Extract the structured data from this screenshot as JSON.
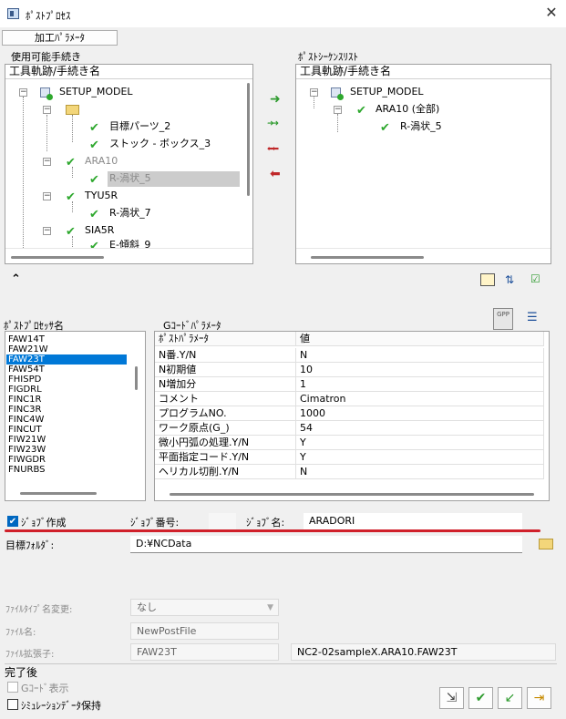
{
  "window": {
    "title": "ﾎﾟｽﾄﾌﾟﾛｾｽ",
    "close": "✕"
  },
  "tabs": {
    "processing_params": "加工ﾊﾟﾗﾒｰﾀ"
  },
  "available": {
    "label": "使用可能手続き",
    "column": "工具軌跡/手続き名",
    "rows": [
      {
        "text": "SETUP_MODEL"
      },
      {
        "text": ""
      },
      {
        "text": "目標パーツ_2"
      },
      {
        "text": "ストック - ボックス_3"
      },
      {
        "text": "ARA10"
      },
      {
        "text": "R-渦状_5"
      },
      {
        "text": "TYU5R"
      },
      {
        "text": "R-渦状_7"
      },
      {
        "text": "SIA5R"
      },
      {
        "text": "E-傾斜_9"
      }
    ]
  },
  "sequence": {
    "label": "ﾎﾟｽﾄｼｰｹﾝｽﾘｽﾄ",
    "column": "工具軌跡/手続き名",
    "rows": [
      {
        "text": "SETUP_MODEL"
      },
      {
        "text": "ARA10 (全部)"
      },
      {
        "text": "R-渦状_5"
      }
    ]
  },
  "processor": {
    "label": "ﾎﾟｽﾄﾌﾟﾛｾｯｻ名",
    "items": [
      "FAW14T",
      "FAW21W",
      "FAW23T",
      "FAW54T",
      "FHISPD",
      "FIGDRL",
      "FINC1R",
      "FINC3R",
      "FINC4W",
      "FINCUT",
      "FIW21W",
      "FIW23W",
      "FIWGDR",
      "FNURBS"
    ],
    "selected": "FAW23T"
  },
  "gcode": {
    "label": "Gｺｰﾄﾞﾊﾟﾗﾒｰﾀ",
    "col_param": "ﾎﾟｽﾄﾊﾟﾗﾒｰﾀ",
    "col_value": "値",
    "rows": [
      {
        "param": "N番.Y/N",
        "value": "N"
      },
      {
        "param": "N初期値",
        "value": "10"
      },
      {
        "param": "N増加分",
        "value": "1"
      },
      {
        "param": "コメント",
        "value": "Cimatron"
      },
      {
        "param": "プログラムNO.",
        "value": "1000"
      },
      {
        "param": "ワーク原点(G_)",
        "value": "54"
      },
      {
        "param": "微小円弧の処理.Y/N",
        "value": "Y"
      },
      {
        "param": "平面指定コード.Y/N",
        "value": "Y"
      },
      {
        "param": "ヘリカル切削.Y/N",
        "value": "N"
      }
    ]
  },
  "job": {
    "create_label": "ｼﾞｮﾌﾞ作成",
    "number_label": "ｼﾞｮﾌﾞ番号:",
    "number_value": "",
    "name_label": "ｼﾞｮﾌﾞ名:",
    "name_value": "ARADORI"
  },
  "target": {
    "label": "目標ﾌｫﾙﾀﾞ:",
    "value": "D:¥NCData"
  },
  "file": {
    "type_label": "ﾌｧｲﾙﾀｲﾌﾟ名変更:",
    "type_value": "なし",
    "name_label": "ﾌｧｲﾙ名:",
    "name_value": "NewPostFile",
    "ext_label": "ﾌｧｲﾙ拡張子:",
    "ext_value": "FAW23T",
    "full_name": "NC2-02sampleX.ARA10.FAW23T"
  },
  "after": {
    "label": "完了後",
    "gcode_display": "Gｺｰﾄﾞ表示",
    "keep_sim": "ｼﾐｭﾚｰｼｮﾝﾃﾞｰﾀ保持"
  },
  "icons": {
    "add": "➜",
    "add_all": "➜➜",
    "remove_all": "⬅⬅",
    "remove": "⬅",
    "collapse": "⌃",
    "check": "✔"
  },
  "colors": {
    "accent": "#0078d7",
    "highlight_line": "#d0202a",
    "check_green": "#2ea82e"
  }
}
